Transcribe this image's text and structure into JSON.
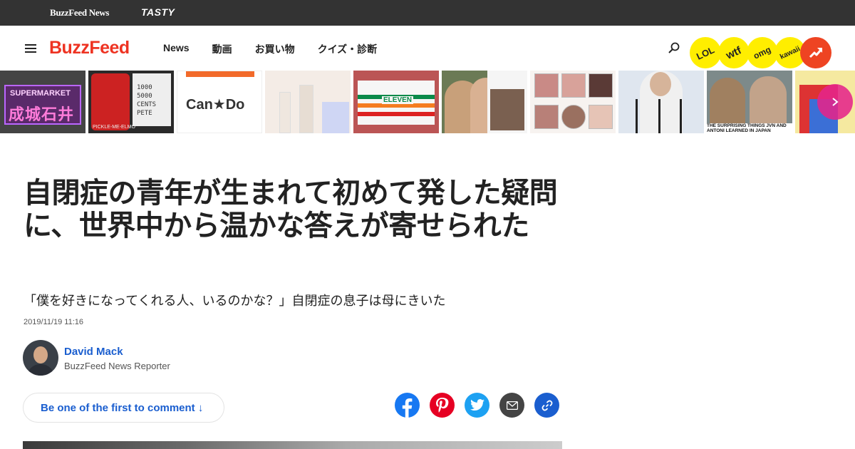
{
  "topbar": {
    "brand_news": "BuzzFeed News",
    "brand_tasty": "TASTY"
  },
  "nav": {
    "logo": "BuzzFeed",
    "links": [
      "News",
      "動画",
      "お買い物",
      "クイズ・診断"
    ]
  },
  "badges": {
    "lol": "LOL",
    "wtf": "wtf",
    "omg": "omg",
    "kawaii": "kawaii",
    "trending_icon": "trending-arrow-icon"
  },
  "strip": {
    "tile1_text_top": "SUPERMARKET",
    "tile1_text_main": "成城石井",
    "tile2_note": "1000\n5000\nCENTS\nPETE",
    "tile2_caption": "PICKLE-ME-ELMO",
    "tile3_text": "Can★Do",
    "tile5_text": "ELEVEN",
    "tile9_caption": "THE SURPRISING THINGS JVN AND ANTONI LEARNED IN JAPAN",
    "next_icon": "chevron-right-icon"
  },
  "article": {
    "title": "自閉症の青年が生まれて初めて発した疑問に、世界中から温かな答えが寄せられた",
    "subtitle": "「僕を好きになってくれる人、いるのかな？」自閉症の息子は母にきいた",
    "date": "2019/11/19 11:16",
    "author_name": "David Mack",
    "author_role": "BuzzFeed News Reporter",
    "comment_cta": "Be one of the first to comment ↓"
  },
  "share": {
    "icons": [
      "facebook-icon",
      "pinterest-icon",
      "twitter-icon",
      "email-icon",
      "link-icon"
    ]
  },
  "colors": {
    "brand_red": "#ee3322",
    "link_blue": "#1a5ecf",
    "badge_yellow": "#ffee00",
    "topbar": "#333333"
  }
}
